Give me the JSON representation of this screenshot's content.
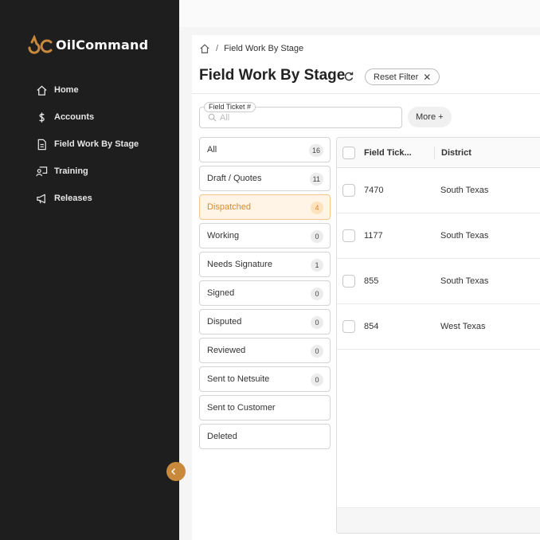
{
  "app": {
    "logo_text": "OilCommand",
    "accent": "#c8893a",
    "sidebar_bg": "#1e1e1e"
  },
  "sidebar": {
    "items": [
      {
        "label": "Home",
        "icon": "home-icon"
      },
      {
        "label": "Accounts",
        "icon": "dollar-icon"
      },
      {
        "label": "Field Work By Stage",
        "icon": "document-icon"
      },
      {
        "label": "Training",
        "icon": "training-icon"
      },
      {
        "label": "Releases",
        "icon": "megaphone-icon"
      }
    ]
  },
  "breadcrumb": {
    "current": "Field Work By Stage"
  },
  "page": {
    "title": "Field Work By Stage",
    "reset_filter_label": "Reset Filter",
    "reset_filter_close": "✕"
  },
  "filter": {
    "label": "Field Ticket #",
    "placeholder": "All",
    "more_label": "More +"
  },
  "stages": [
    {
      "label": "All",
      "count": "16"
    },
    {
      "label": "Draft / Quotes",
      "count": "11"
    },
    {
      "label": "Dispatched",
      "count": "4",
      "active": true
    },
    {
      "label": "Working",
      "count": "0"
    },
    {
      "label": "Needs Signature",
      "count": "1"
    },
    {
      "label": "Signed",
      "count": "0"
    },
    {
      "label": "Disputed",
      "count": "0"
    },
    {
      "label": "Reviewed",
      "count": "0"
    },
    {
      "label": "Sent to Netsuite",
      "count": "0"
    },
    {
      "label": "Sent to Customer",
      "count": ""
    },
    {
      "label": "Deleted",
      "count": ""
    }
  ],
  "table": {
    "columns": [
      "Field Tick...",
      "District"
    ],
    "rows": [
      {
        "ticket": "7470",
        "district": "South Texas"
      },
      {
        "ticket": "1177",
        "district": "South Texas"
      },
      {
        "ticket": "855",
        "district": "South Texas"
      },
      {
        "ticket": "854",
        "district": "West Texas"
      }
    ]
  }
}
